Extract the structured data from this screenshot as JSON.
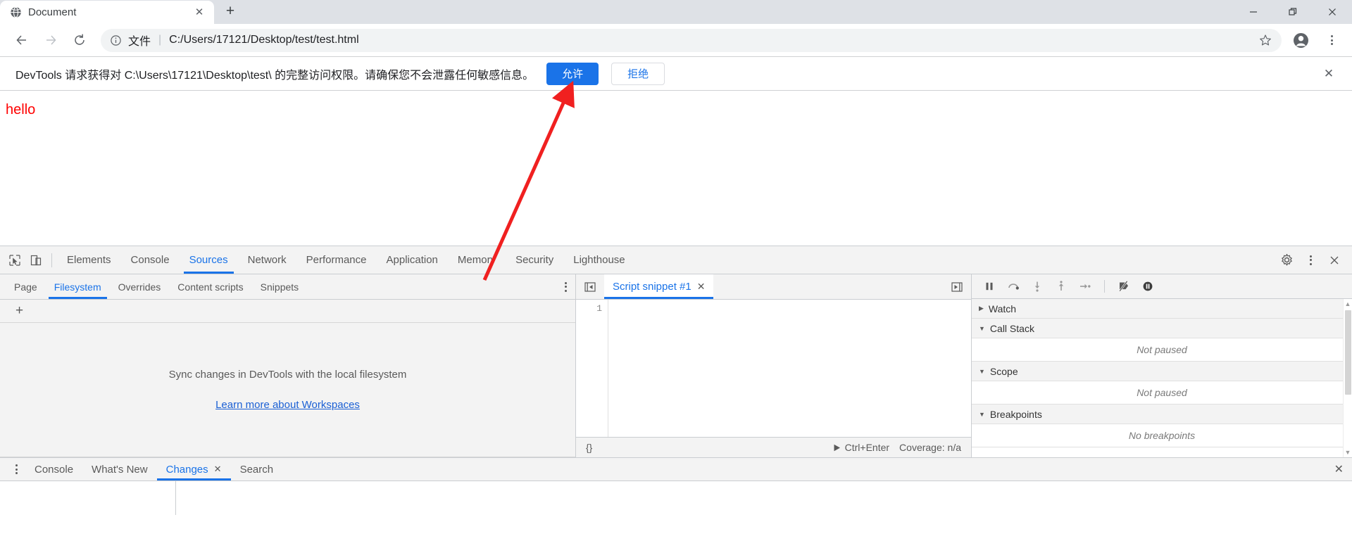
{
  "browser": {
    "tab": {
      "title": "Document",
      "favicon": "globe-icon",
      "close": "✕"
    },
    "newtab_label": "+",
    "window_controls": {
      "minimize": "—",
      "maximize": "❐",
      "close": "✕"
    },
    "nav": {
      "back": "←",
      "forward": "→",
      "reload": "↻"
    },
    "omnibox": {
      "info_icon": "info-circle-icon",
      "scheme_label": "文件",
      "separator": "|",
      "url": "C:/Users/17121/Desktop/test/test.html",
      "star": "☆",
      "profile": "profile-avatar-icon",
      "menu": "kebab-menu-icon"
    }
  },
  "infobar": {
    "message": "DevTools 请求获得对 C:\\Users\\17121\\Desktop\\test\\ 的完整访问权限。请确保您不会泄露任何敏感信息。",
    "allow_label": "允许",
    "deny_label": "拒绝",
    "close": "✕",
    "primary_color": "#1a73e8"
  },
  "page": {
    "hello_text": "hello",
    "hello_color": "#ff0000"
  },
  "devtools": {
    "inspect_icon": "inspect-cursor-icon",
    "device_icon": "device-toolbar-icon",
    "main_tabs": [
      {
        "label": "Elements",
        "active": false
      },
      {
        "label": "Console",
        "active": false
      },
      {
        "label": "Sources",
        "active": true
      },
      {
        "label": "Network",
        "active": false
      },
      {
        "label": "Performance",
        "active": false
      },
      {
        "label": "Application",
        "active": false
      },
      {
        "label": "Memory",
        "active": false
      },
      {
        "label": "Security",
        "active": false
      },
      {
        "label": "Lighthouse",
        "active": false
      }
    ],
    "settings_icon": "gear-icon",
    "more_icon": "kebab-menu-icon",
    "close_icon": "close-icon",
    "navigator": {
      "tabs": [
        {
          "label": "Page",
          "active": false
        },
        {
          "label": "Filesystem",
          "active": true
        },
        {
          "label": "Overrides",
          "active": false
        },
        {
          "label": "Content scripts",
          "active": false
        },
        {
          "label": "Snippets",
          "active": false
        }
      ],
      "more_icon": "kebab-menu-icon",
      "add_folder_label": "+",
      "empty_text": "Sync changes in DevTools with the local filesystem",
      "empty_link": "Learn more about Workspaces"
    },
    "editor": {
      "prev_icon": "previous-file-icon",
      "next_icon": "next-file-icon",
      "tab_label": "Script snippet #1",
      "tab_close": "✕",
      "line_number": "1",
      "code": "",
      "pretty_print_label": "{}",
      "run_icon": "play-icon",
      "run_shortcut": "Ctrl+Enter",
      "coverage_label": "Coverage: n/a"
    },
    "debugger": {
      "toolbar": [
        {
          "name": "resume-icon",
          "title": "Resume"
        },
        {
          "name": "step-over-icon",
          "title": "Step over"
        },
        {
          "name": "step-into-icon",
          "title": "Step into"
        },
        {
          "name": "step-out-icon",
          "title": "Step out"
        },
        {
          "name": "step-icon",
          "title": "Step"
        },
        {
          "name": "deactivate-breakpoints-icon",
          "title": "Deactivate breakpoints"
        },
        {
          "name": "pause-on-exceptions-icon",
          "title": "Pause on exceptions"
        }
      ],
      "sections": [
        {
          "label": "Watch",
          "expanded": false,
          "content": null
        },
        {
          "label": "Call Stack",
          "expanded": true,
          "content": "Not paused"
        },
        {
          "label": "Scope",
          "expanded": true,
          "content": "Not paused"
        },
        {
          "label": "Breakpoints",
          "expanded": true,
          "content": "No breakpoints"
        }
      ],
      "collapsed_arrow": "▶",
      "expanded_arrow": "▼",
      "scroll_up": "▲",
      "scroll_down": "▼"
    },
    "drawer": {
      "more_icon": "kebab-menu-icon",
      "tabs": [
        {
          "label": "Console",
          "active": false,
          "closable": false
        },
        {
          "label": "What's New",
          "active": false,
          "closable": false
        },
        {
          "label": "Changes",
          "active": true,
          "closable": true
        },
        {
          "label": "Search",
          "active": false,
          "closable": false
        }
      ],
      "tab_close": "✕",
      "close_drawer": "✕"
    }
  },
  "annotation": {
    "arrow_color": "#f02020",
    "name": "red-arrow-pointing-to-allow-button"
  }
}
